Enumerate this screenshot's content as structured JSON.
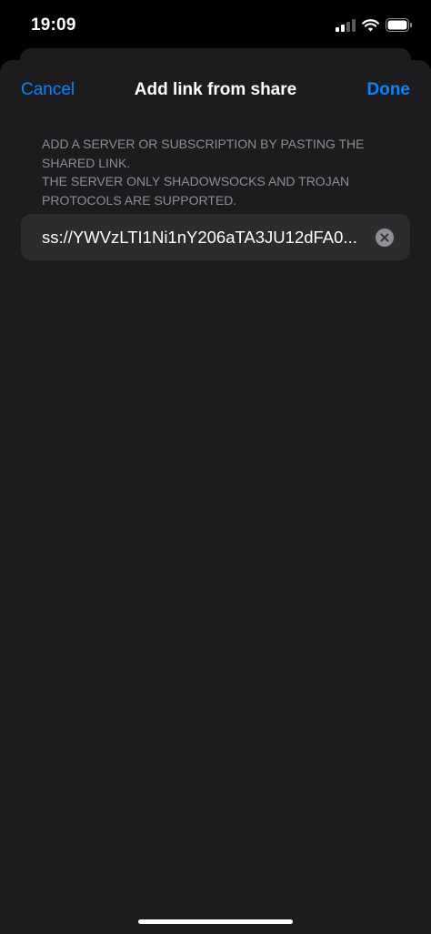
{
  "status_bar": {
    "time": "19:09",
    "icons": [
      "signal-icon",
      "wifi-icon",
      "battery-icon"
    ]
  },
  "nav": {
    "cancel_label": "Cancel",
    "title": "Add link from share",
    "done_label": "Done"
  },
  "section": {
    "header_line1": "ADD A SERVER OR SUBSCRIPTION BY PASTING THE SHARED LINK.",
    "header_line2": "THE SERVER ONLY SHADOWSOCKS AND TROJAN PROTOCOLS ARE SUPPORTED."
  },
  "link_field": {
    "value": "ss://YWVzLTI1Ni1nY206aTA3JU12dFA0..."
  },
  "colors": {
    "accent": "#0a84ff",
    "sheet_background": "#1c1c1e",
    "field_background": "#2c2c2e",
    "secondary_text": "#8e8e93"
  }
}
